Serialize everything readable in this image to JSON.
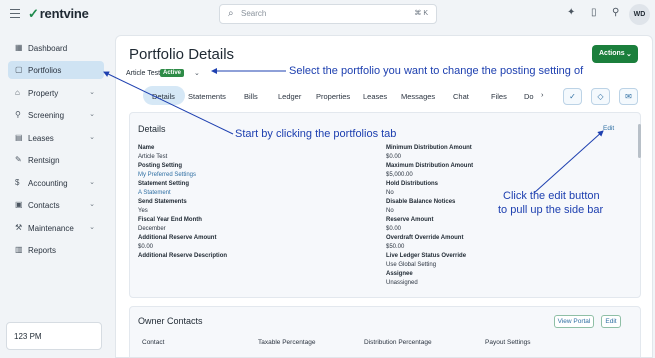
{
  "topbar": {
    "logo": "rentvine",
    "search_placeholder": "Search",
    "search_shortcut": "⌘ K",
    "avatar": "WD"
  },
  "sidebar": {
    "items": [
      {
        "label": "Dashboard",
        "icon": "grid-icon"
      },
      {
        "label": "Portfolios",
        "icon": "portfolio-icon"
      },
      {
        "label": "Property",
        "icon": "property-icon"
      },
      {
        "label": "Screening",
        "icon": "screening-icon"
      },
      {
        "label": "Leases",
        "icon": "leases-icon"
      },
      {
        "label": "Rentsign",
        "icon": "rentsign-icon"
      },
      {
        "label": "Accounting",
        "icon": "dollar-icon"
      },
      {
        "label": "Contacts",
        "icon": "contacts-icon"
      },
      {
        "label": "Maintenance",
        "icon": "wrench-icon"
      },
      {
        "label": "Reports",
        "icon": "reports-icon"
      }
    ],
    "time": "123 PM"
  },
  "page": {
    "title": "Portfolio Details",
    "actions_label": "Actions",
    "portfolio_name": "Article Test",
    "status_badge": "Active"
  },
  "tabs": [
    "Details",
    "Statements",
    "Bills",
    "Ledger",
    "Properties",
    "Leases",
    "Messages",
    "Chat",
    "Files",
    "Do"
  ],
  "details": {
    "title": "Details",
    "edit_label": "Edit",
    "left_fields": [
      {
        "label": "Name",
        "value": "Article Test"
      },
      {
        "label": "Posting Setting",
        "value": "My Preferred Settings"
      },
      {
        "label": "Statement Setting",
        "value": "A Statement"
      },
      {
        "label": "Send Statements",
        "value": "Yes"
      },
      {
        "label": "Fiscal Year End Month",
        "value": "December"
      },
      {
        "label": "Additional Reserve Amount",
        "value": "$0.00"
      },
      {
        "label": "Additional Reserve Description",
        "value": ""
      }
    ],
    "right_fields": [
      {
        "label": "Minimum Distribution Amount",
        "value": "$0.00"
      },
      {
        "label": "Maximum Distribution Amount",
        "value": "$5,000.00"
      },
      {
        "label": "Hold Distributions",
        "value": "No"
      },
      {
        "label": "Disable Balance Notices",
        "value": "No"
      },
      {
        "label": "Reserve Amount",
        "value": "$0.00"
      },
      {
        "label": "Overdraft Override Amount",
        "value": "$50.00"
      },
      {
        "label": "Live Ledger Status Override",
        "value": "Use Global Setting"
      },
      {
        "label": "Assignee",
        "value": "Unassigned"
      }
    ]
  },
  "owner_contacts": {
    "title": "Owner Contacts",
    "view_portal_label": "View Portal",
    "edit_label": "Edit",
    "columns": [
      "Contact",
      "Taxable Percentage",
      "Distribution Percentage",
      "Payout Settings"
    ]
  },
  "annotations": {
    "select_portfolio": "Select the portfolio you want to change the posting setting of",
    "start_clicking": "Start by clicking the portfolios tab",
    "click_edit_line1": "Click the edit button",
    "click_edit_line2": "to pull up the side bar"
  },
  "colors": {
    "accent_green": "#1b7f3c",
    "active_nav": "#cfe3f3",
    "annotation_blue": "#1e40b0"
  }
}
